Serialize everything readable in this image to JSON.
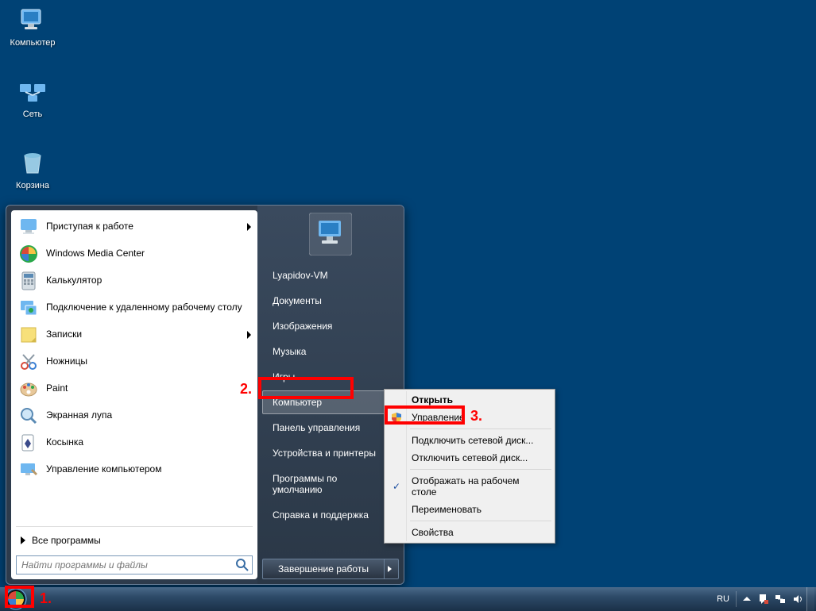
{
  "desktop": {
    "icons": [
      {
        "label": "Компьютер"
      },
      {
        "label": "Сеть"
      },
      {
        "label": "Корзина"
      }
    ]
  },
  "start_menu": {
    "left_items": [
      {
        "label": "Приступая к работе",
        "has_arrow": true
      },
      {
        "label": "Windows Media Center"
      },
      {
        "label": "Калькулятор"
      },
      {
        "label": "Подключение к удаленному рабочему столу"
      },
      {
        "label": "Записки",
        "has_arrow": true
      },
      {
        "label": "Ножницы"
      },
      {
        "label": "Paint"
      },
      {
        "label": "Экранная лупа"
      },
      {
        "label": "Косынка"
      },
      {
        "label": "Управление компьютером"
      }
    ],
    "all_programs": "Все программы",
    "search_placeholder": "Найти программы и файлы",
    "right_items": [
      "Lyapidov-VM",
      "Документы",
      "Изображения",
      "Музыка",
      "Игры",
      "Компьютер",
      "Панель управления",
      "Устройства и принтеры",
      "Программы по умолчанию",
      "Справка и поддержка"
    ],
    "right_selected_index": 5,
    "shutdown_label": "Завершение работы"
  },
  "context_menu": {
    "items": [
      {
        "label": "Открыть",
        "bold": true
      },
      {
        "label": "Управление",
        "shield": true
      },
      {
        "sep": true
      },
      {
        "label": "Подключить сетевой диск..."
      },
      {
        "label": "Отключить сетевой диск..."
      },
      {
        "sep": true
      },
      {
        "label": "Отображать на рабочем столе",
        "checked": true
      },
      {
        "label": "Переименовать"
      },
      {
        "sep": true
      },
      {
        "label": "Свойства"
      }
    ]
  },
  "taskbar": {
    "lang": "RU"
  },
  "annotations": {
    "n1": "1.",
    "n2": "2.",
    "n3": "3."
  }
}
